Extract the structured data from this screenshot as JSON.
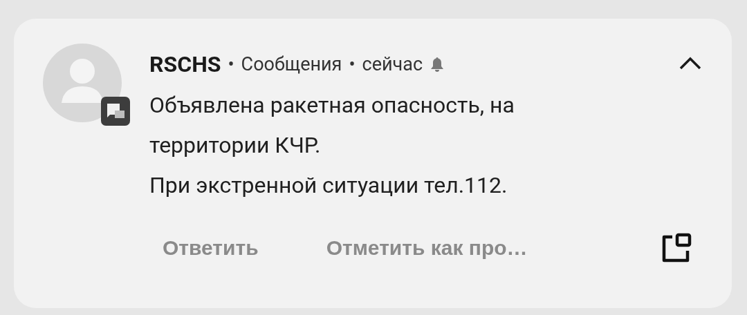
{
  "notification": {
    "app_name": "RSCHS",
    "channel": "Сообщения",
    "time": "сейчас",
    "separator": "•",
    "expanded": true,
    "message": [
      "Объявлена ракетная опасность, на территории КЧР.",
      "При экстренной ситуации тел.112."
    ],
    "actions": [
      "Ответить",
      "Отметить как про…"
    ]
  }
}
